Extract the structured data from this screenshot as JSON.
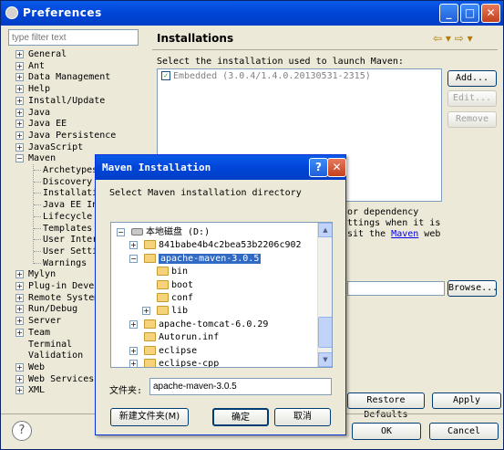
{
  "window": {
    "title": "Preferences",
    "buttons": {
      "min": "_",
      "max": "□",
      "close": "✕"
    }
  },
  "filter": {
    "placeholder": "type filter text"
  },
  "tree": [
    {
      "label": "General",
      "expander": "+"
    },
    {
      "label": "Ant",
      "expander": "+"
    },
    {
      "label": "Data Management",
      "expander": "+"
    },
    {
      "label": "Help",
      "expander": "+"
    },
    {
      "label": "Install/Update",
      "expander": "+"
    },
    {
      "label": "Java",
      "expander": "+"
    },
    {
      "label": "Java EE",
      "expander": "+"
    },
    {
      "label": "Java Persistence",
      "expander": "+"
    },
    {
      "label": "JavaScript",
      "expander": "+"
    },
    {
      "label": "Maven",
      "expander": "−"
    },
    {
      "label": "Archetypes",
      "child": true
    },
    {
      "label": "Discovery",
      "child": true
    },
    {
      "label": "Installations",
      "child": true
    },
    {
      "label": "Java EE Inte",
      "child": true
    },
    {
      "label": "Lifecycle Ma",
      "child": true
    },
    {
      "label": "Templates",
      "child": true
    },
    {
      "label": "User Interf",
      "child": true
    },
    {
      "label": "User Setting",
      "child": true
    },
    {
      "label": "Warnings",
      "child": true
    },
    {
      "label": "Mylyn",
      "expander": "+"
    },
    {
      "label": "Plug-in Develop",
      "expander": "+"
    },
    {
      "label": "Remote Systems",
      "expander": "+"
    },
    {
      "label": "Run/Debug",
      "expander": "+"
    },
    {
      "label": "Server",
      "expander": "+"
    },
    {
      "label": "Team",
      "expander": "+"
    },
    {
      "label": "Terminal",
      "expander": ""
    },
    {
      "label": "Validation",
      "expander": ""
    },
    {
      "label": "Web",
      "expander": "+"
    },
    {
      "label": "Web Services",
      "expander": "+"
    },
    {
      "label": "XML",
      "expander": "+"
    }
  ],
  "right": {
    "title": "Installations",
    "nav": "⇦ ▾ ⇨ ▾",
    "label": "Select the installation used to launch Maven:",
    "installation": "Embedded (3.0.4/1.4.0.20130531-2315)",
    "add_label": "Add...",
    "edit_label": "Edit...",
    "remove_label": "Remove",
    "partial1": "or dependency",
    "partial2": "ttings when it is",
    "partial3a": "sit the ",
    "partial3_link": "Maven",
    "partial3b": " web",
    "browse_label": "Browse...",
    "restore_label": "Restore Defaults",
    "apply_label": "Apply"
  },
  "bottom": {
    "ok_label": "OK",
    "cancel_label": "Cancel",
    "help_glyph": "?"
  },
  "dialog": {
    "title": "Maven Installation",
    "help": "?",
    "close": "✕",
    "message": "Select Maven installation directory",
    "tree": [
      {
        "label": "本地磁盘 (D:)",
        "expander": "−",
        "indent": 0,
        "drive": true
      },
      {
        "label": "841babe4b4c2bea53b2206c902",
        "expander": "+",
        "indent": 1
      },
      {
        "label": "apache-maven-3.0.5",
        "expander": "−",
        "indent": 1,
        "selected": true
      },
      {
        "label": "bin",
        "expander": "",
        "indent": 2
      },
      {
        "label": "boot",
        "expander": "",
        "indent": 2
      },
      {
        "label": "conf",
        "expander": "",
        "indent": 2
      },
      {
        "label": "lib",
        "expander": "+",
        "indent": 2
      },
      {
        "label": "apache-tomcat-6.0.29",
        "expander": "+",
        "indent": 1
      },
      {
        "label": "Autorun.inf",
        "expander": "",
        "indent": 1
      },
      {
        "label": "eclipse",
        "expander": "+",
        "indent": 1
      },
      {
        "label": "eclipse-cpp",
        "expander": "+",
        "indent": 1
      }
    ],
    "folder_label": "文件夹:",
    "folder_value": "apache-maven-3.0.5",
    "new_folder_label": "新建文件夹(M)",
    "ok_label": "确定",
    "cancel_label": "取消"
  },
  "colors": {
    "titlebar": "#0045d8",
    "selection": "#316ac5",
    "link": "#0000ee"
  }
}
